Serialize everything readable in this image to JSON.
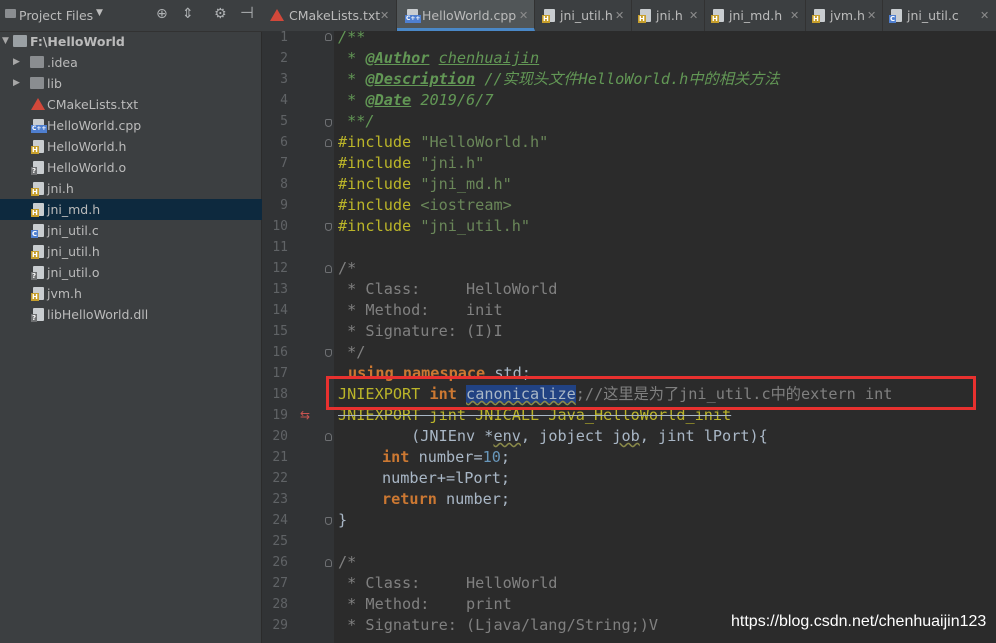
{
  "sidebar": {
    "title": "Project Files",
    "items": [
      {
        "label": "F:\\HelloWorld",
        "kind": "root"
      },
      {
        "label": ".idea",
        "kind": "folder"
      },
      {
        "label": "lib",
        "kind": "folder"
      },
      {
        "label": "CMakeLists.txt",
        "kind": "cmake"
      },
      {
        "label": "HelloWorld.cpp",
        "kind": "cpp"
      },
      {
        "label": "HelloWorld.h",
        "kind": "h"
      },
      {
        "label": "HelloWorld.o",
        "kind": "o"
      },
      {
        "label": "jni.h",
        "kind": "h"
      },
      {
        "label": "jni_md.h",
        "kind": "h",
        "selected": true
      },
      {
        "label": "jni_util.c",
        "kind": "c"
      },
      {
        "label": "jni_util.h",
        "kind": "h"
      },
      {
        "label": "jni_util.o",
        "kind": "o"
      },
      {
        "label": "jvm.h",
        "kind": "h"
      },
      {
        "label": "libHelloWorld.dll",
        "kind": "o"
      }
    ]
  },
  "tabs": [
    {
      "label": "CMakeLists.txt",
      "kind": "cmake"
    },
    {
      "label": "HelloWorld.cpp",
      "kind": "cpp",
      "active": true
    },
    {
      "label": "jni_util.h",
      "kind": "h"
    },
    {
      "label": "jni.h",
      "kind": "h"
    },
    {
      "label": "jni_md.h",
      "kind": "h"
    },
    {
      "label": "jvm.h",
      "kind": "h"
    },
    {
      "label": "jni_util.c",
      "kind": "c"
    }
  ],
  "editor": {
    "line_numbers": [
      "1",
      "2",
      "3",
      "4",
      "5",
      "6",
      "7",
      "8",
      "9",
      "10",
      "11",
      "12",
      "13",
      "14",
      "15",
      "16",
      "17",
      "18",
      "19",
      "20",
      "21",
      "22",
      "23",
      "24",
      "25",
      "26",
      "27",
      "28",
      "29"
    ],
    "code": {
      "l1": "/**",
      "l2_pre": " * ",
      "l2_tag": "@Author",
      "l2_val": "chenhuaijin",
      "l3_pre": " * ",
      "l3_tag": "@Description",
      "l3_val": "//实现头文件HelloWorld.h中的相关方法",
      "l4_pre": " * ",
      "l4_tag": "@Date",
      "l4_val": "2019/6/7",
      "l5": " **/",
      "l6_kw": "#include",
      "l6_str": "\"HelloWorld.h\"",
      "l7_kw": "#include",
      "l7_str": "\"jni.h\"",
      "l8_kw": "#include",
      "l8_str": "\"jni_md.h\"",
      "l9_kw": "#include",
      "l9_str": "<iostream>",
      "l10_kw": "#include",
      "l10_str": "\"jni_util.h\"",
      "l12": "/*",
      "l13": " * Class:     HelloWorld",
      "l14": " * Method:    init",
      "l15": " * Signature: (I)I",
      "l16": " */",
      "l17_kw1": "using",
      "l17_kw2": "namespace",
      "l17_rest": "std;",
      "l18_macro": "JNIEXPORT",
      "l18_kw": "int",
      "l18_fn": "canonicalize",
      "l18_rest": ";//这里是为了jni_util.c中的extern int",
      "l19_text": "JNIEXPORT jint JNICALL Java_HelloWorld_init",
      "l20_a": "        (JNIEnv *",
      "l20_env": "env",
      "l20_b": ", jobject ",
      "l20_job": "job",
      "l20_c": ", jint lPort){",
      "l21_kw": "int",
      "l21_a": " number=",
      "l21_num": "10",
      "l21_b": ";",
      "l22": "number+=lPort;",
      "l23_kw": "return",
      "l23_rest": " number;",
      "l24": "}",
      "l26": "/*",
      "l27": " * Class:     HelloWorld",
      "l28": " * Method:    print",
      "l29": " * Signature: (Ljava/lang/String;)V"
    }
  },
  "watermark": "https://blog.csdn.net/chenhuaijin123"
}
